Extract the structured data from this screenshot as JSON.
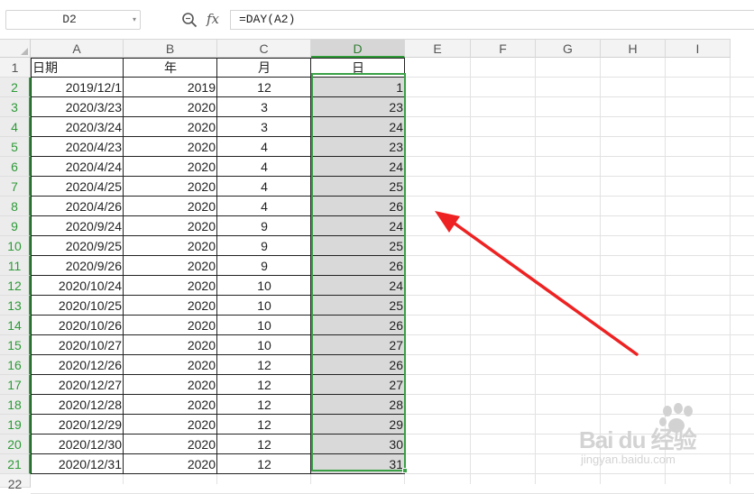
{
  "formula_bar": {
    "name_box": "D2",
    "name_box_icon": "chevron-down-icon",
    "zoom_icon": "zoom-icon",
    "fx_label": "fx",
    "formula": "=DAY(A2)"
  },
  "columns": [
    "A",
    "B",
    "C",
    "D",
    "E",
    "F",
    "G",
    "H",
    "I"
  ],
  "active_column": "D",
  "headers": {
    "date": "日期",
    "year": "年",
    "month": "月",
    "day": "日"
  },
  "rows": [
    {
      "date": "2019/12/1",
      "year": "2019",
      "month": "12",
      "day": "1"
    },
    {
      "date": "2020/3/23",
      "year": "2020",
      "month": "3",
      "day": "23"
    },
    {
      "date": "2020/3/24",
      "year": "2020",
      "month": "3",
      "day": "24"
    },
    {
      "date": "2020/4/23",
      "year": "2020",
      "month": "4",
      "day": "23"
    },
    {
      "date": "2020/4/24",
      "year": "2020",
      "month": "4",
      "day": "24"
    },
    {
      "date": "2020/4/25",
      "year": "2020",
      "month": "4",
      "day": "25"
    },
    {
      "date": "2020/4/26",
      "year": "2020",
      "month": "4",
      "day": "26"
    },
    {
      "date": "2020/9/24",
      "year": "2020",
      "month": "9",
      "day": "24"
    },
    {
      "date": "2020/9/25",
      "year": "2020",
      "month": "9",
      "day": "25"
    },
    {
      "date": "2020/9/26",
      "year": "2020",
      "month": "9",
      "day": "26"
    },
    {
      "date": "2020/10/24",
      "year": "2020",
      "month": "10",
      "day": "24"
    },
    {
      "date": "2020/10/25",
      "year": "2020",
      "month": "10",
      "day": "25"
    },
    {
      "date": "2020/10/26",
      "year": "2020",
      "month": "10",
      "day": "26"
    },
    {
      "date": "2020/10/27",
      "year": "2020",
      "month": "10",
      "day": "27"
    },
    {
      "date": "2020/12/26",
      "year": "2020",
      "month": "12",
      "day": "26"
    },
    {
      "date": "2020/12/27",
      "year": "2020",
      "month": "12",
      "day": "27"
    },
    {
      "date": "2020/12/28",
      "year": "2020",
      "month": "12",
      "day": "28"
    },
    {
      "date": "2020/12/29",
      "year": "2020",
      "month": "12",
      "day": "29"
    },
    {
      "date": "2020/12/30",
      "year": "2020",
      "month": "12",
      "day": "30"
    },
    {
      "date": "2020/12/31",
      "year": "2020",
      "month": "12",
      "day": "31"
    }
  ],
  "row_numbers": [
    "1",
    "2",
    "3",
    "4",
    "5",
    "6",
    "7",
    "8",
    "9",
    "10",
    "11",
    "12",
    "13",
    "14",
    "15",
    "16",
    "17",
    "18",
    "19",
    "20",
    "21",
    "22"
  ],
  "selected_rows": [
    "2",
    "3",
    "4",
    "5",
    "6",
    "7",
    "8",
    "9",
    "10",
    "11",
    "12",
    "13",
    "14",
    "15",
    "16",
    "17",
    "18",
    "19",
    "20",
    "21"
  ],
  "annotation": {
    "type": "arrow",
    "color": "#ee2222"
  },
  "watermark": {
    "brand": "Bai du 经验",
    "url": "jingyan.baidu.com"
  },
  "colors": {
    "selection": "#3aa046",
    "selected_fill": "#d9d9d9",
    "arrow": "#ee2222"
  }
}
